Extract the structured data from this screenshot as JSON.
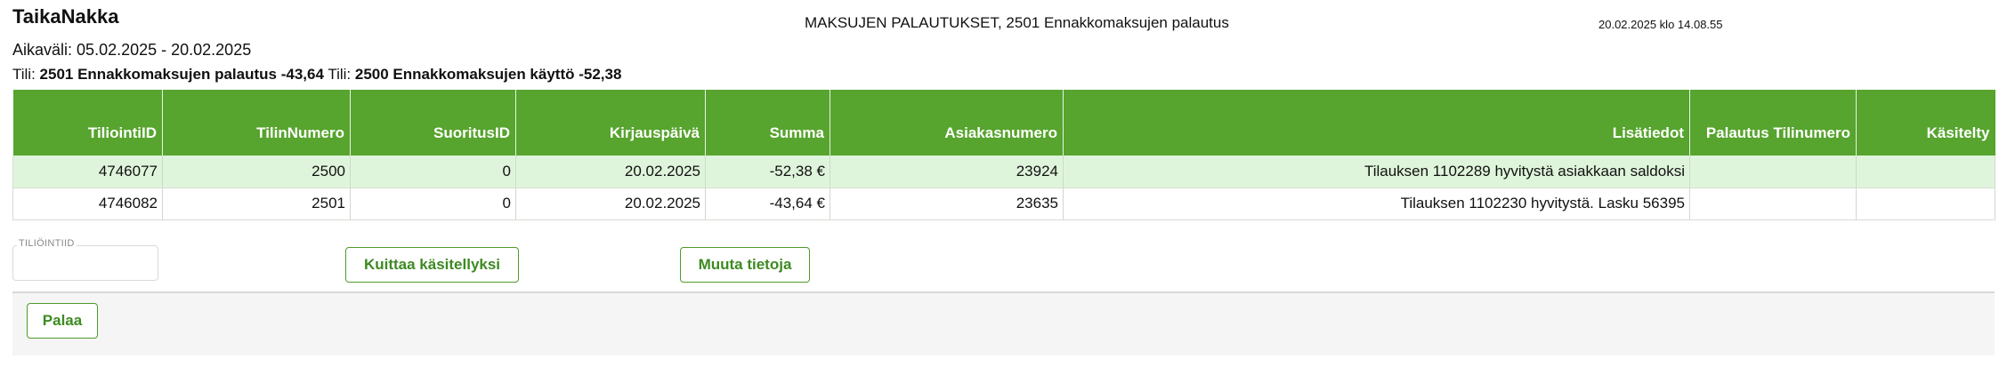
{
  "header": {
    "app_name": "TaikaNakka",
    "report_title": "MAKSUJEN PALAUTUKSET, 2501 Ennakkomaksujen palautus",
    "timestamp": "20.02.2025 klo 14.08.55"
  },
  "summary": {
    "period_label": "Aikaväli:",
    "period_value": "05.02.2025 - 20.02.2025",
    "account_prefix_1": "Tili:",
    "account_1": "2501 Ennakkomaksujen palautus -43,64",
    "account_prefix_2": "Tili:",
    "account_2": "2500 Ennakkomaksujen käyttö -52,38"
  },
  "table": {
    "columns": [
      "TiliointiID",
      "TilinNumero",
      "SuoritusID",
      "Kirjauspäivä",
      "Summa",
      "Asiakasnumero",
      "Lisätiedot",
      "Palautus Tilinumero",
      "Käsitelty"
    ],
    "rows": [
      [
        "4746077",
        "2500",
        "0",
        "20.02.2025",
        "-52,38 €",
        "23924",
        "Tilauksen 1102289 hyvitystä asiakkaan saldoksi",
        "",
        ""
      ],
      [
        "4746082",
        "2501",
        "0",
        "20.02.2025",
        "-43,64 €",
        "23635",
        "Tilauksen 1102230 hyvitystä. Lasku 56395",
        "",
        ""
      ]
    ]
  },
  "form": {
    "id_field_label": "TILIÖINTIID",
    "id_field_value": ""
  },
  "buttons": {
    "acknowledge": "Kuittaa käsitellyksi",
    "edit": "Muuta tietoja",
    "back": "Palaa"
  },
  "colors": {
    "header_green": "#57a42e",
    "row_highlight": "#dff5db",
    "button_text": "#3d8a22"
  }
}
